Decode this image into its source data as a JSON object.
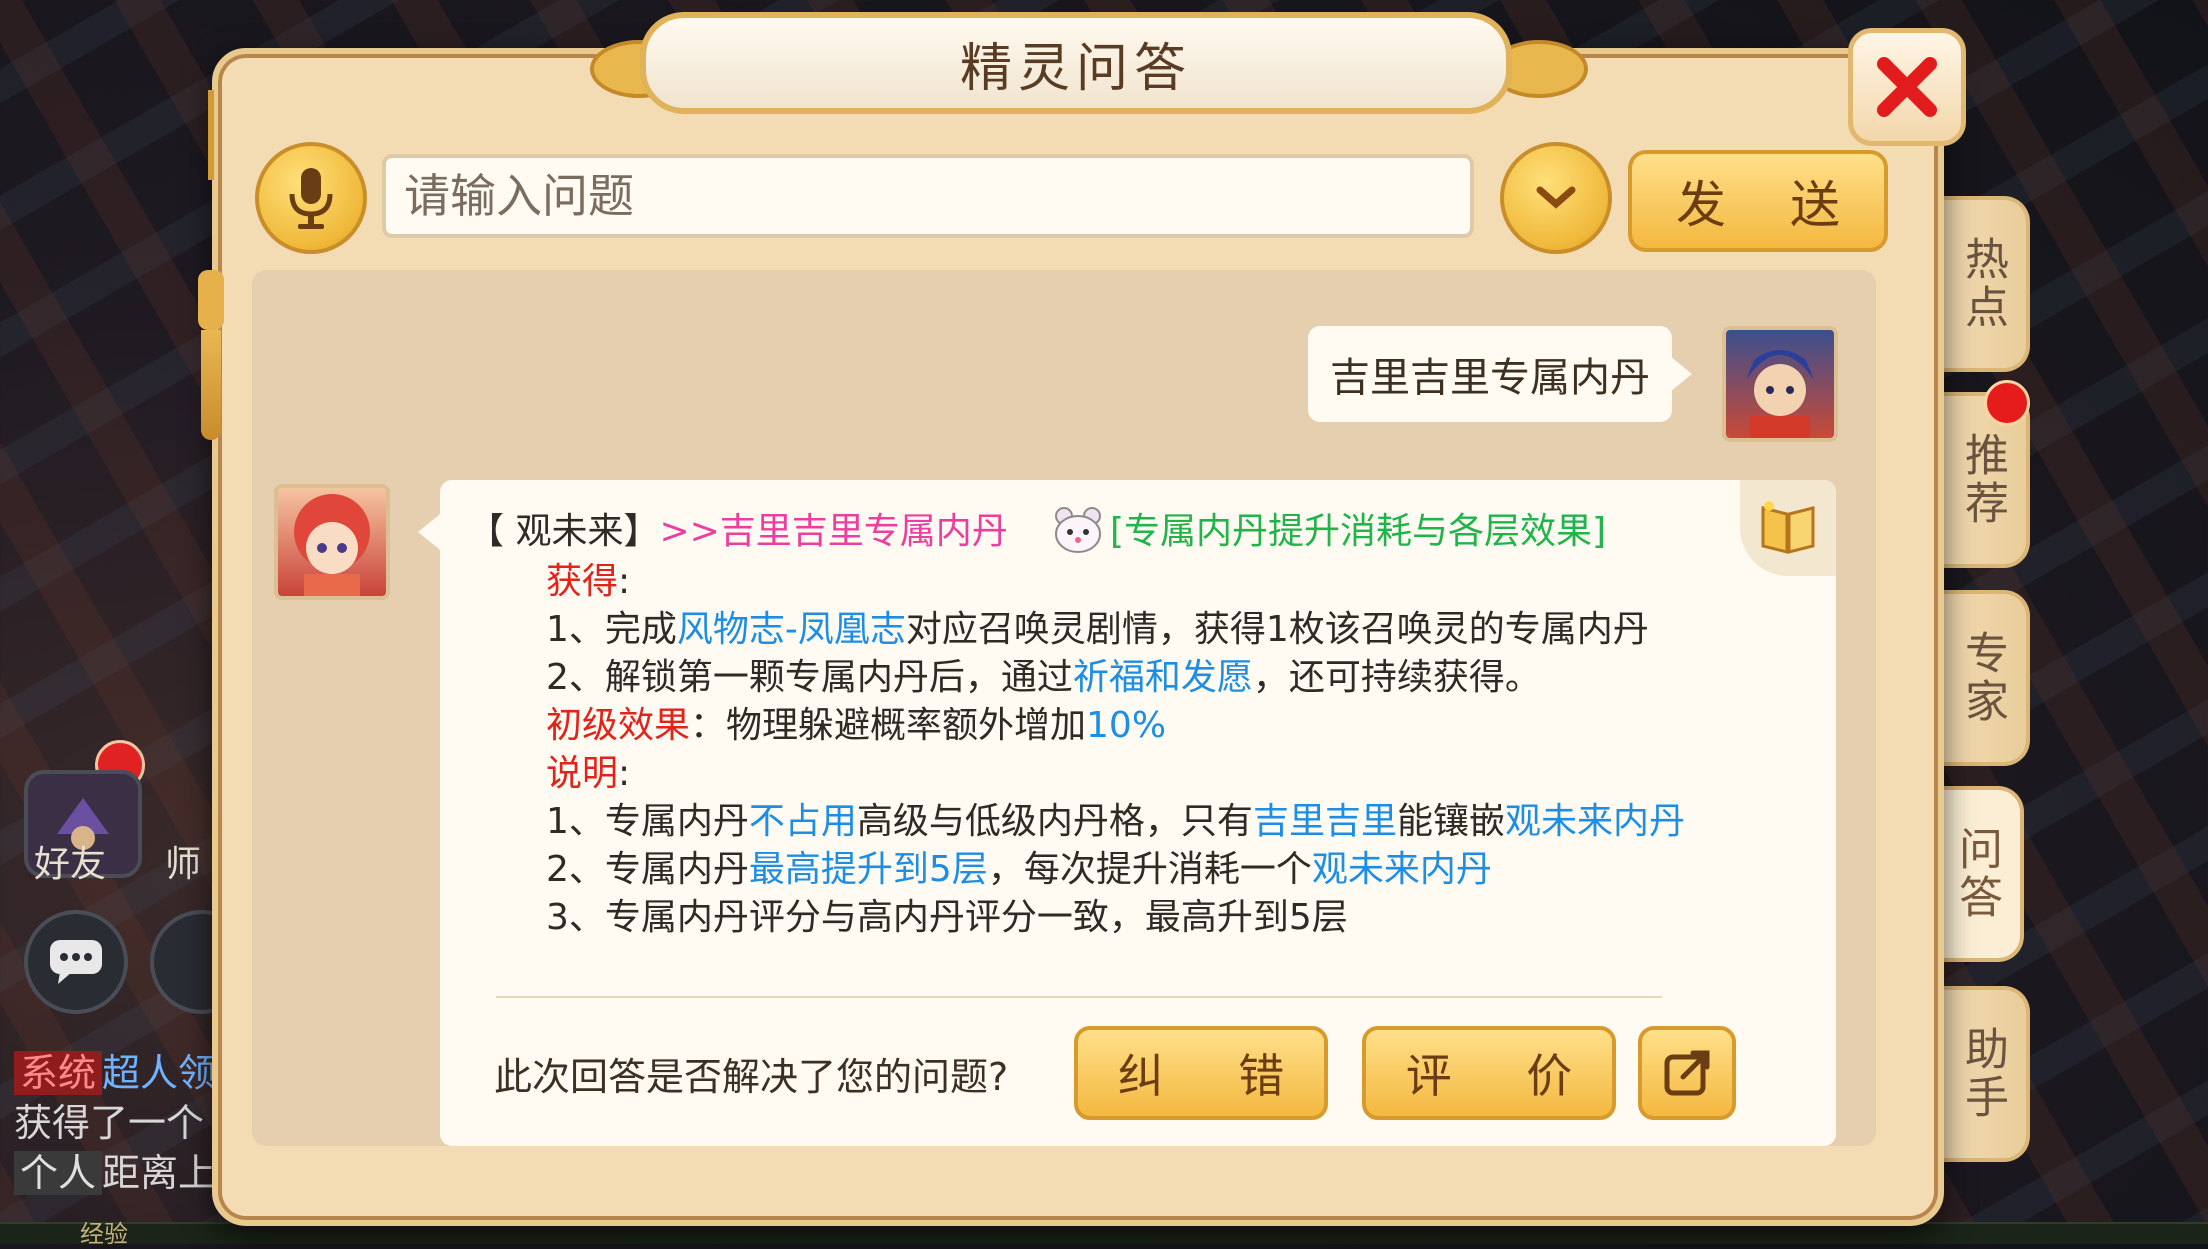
{
  "dialog": {
    "title": "精灵问答",
    "input_placeholder": "请输入问题",
    "send_label": "发 送"
  },
  "conversation": {
    "user_question": "吉里吉里专属内丹",
    "answer": {
      "source_tag": "【 观未来】",
      "link_title": ">>吉里吉里专属内丹",
      "related_link": "[专属内丹提升消耗与各层效果]",
      "obtain_header": "获得",
      "obtain_1_pre": "1、完成",
      "obtain_1_link": "风物志-凤凰志",
      "obtain_1_post": "对应召唤灵剧情，获得1枚该召唤灵的专属内丹",
      "obtain_2_pre": "2、解锁第一颗专属内丹后，通过",
      "obtain_2_link": "祈福和发愿",
      "obtain_2_post": "，还可持续获得。",
      "effect_header": "初级效果",
      "effect_text": "：物理躲避概率额外增加",
      "effect_value": "10%",
      "note_header": "说明",
      "note_1_a": "1、专属内丹",
      "note_1_b": "不占用",
      "note_1_c": "高级与低级内丹格，只有",
      "note_1_d": "吉里吉里",
      "note_1_e": "能镶嵌",
      "note_1_f": "观未来内丹",
      "note_2_a": "2、专属内丹",
      "note_2_b": "最高提升到5层",
      "note_2_c": "，每次提升消耗一个",
      "note_2_d": "观未来内丹",
      "note_3": "3、专属内丹评分与高内丹评分一致，最高升到5层"
    },
    "feedback_question": "此次回答是否解决了您的问题?",
    "correct_label": "纠 错",
    "rate_label": "评 价"
  },
  "side_tabs": [
    "热点",
    "推荐",
    "专家",
    "问答",
    "助手"
  ],
  "background": {
    "friend_label": "好友",
    "master_label": "师",
    "chat_system_tag": "系统",
    "chat_system_text": "超人领",
    "chat_line_2": "获得了一个",
    "chat_person_tag": "个人",
    "chat_person_text": "距离上",
    "xp_label": "经验"
  },
  "colors": {
    "panel_bg": "#f3dcb3",
    "gold_button": "#f4b840",
    "red_text": "#e2231a",
    "blue_link": "#1d8ee6",
    "pink_link": "#ec3ea0",
    "green_link": "#21b44a"
  },
  "icons": [
    "microphone-icon",
    "chevron-down-icon",
    "close-icon",
    "book-icon",
    "bear-icon",
    "share-icon",
    "chat-bubble-icon"
  ]
}
